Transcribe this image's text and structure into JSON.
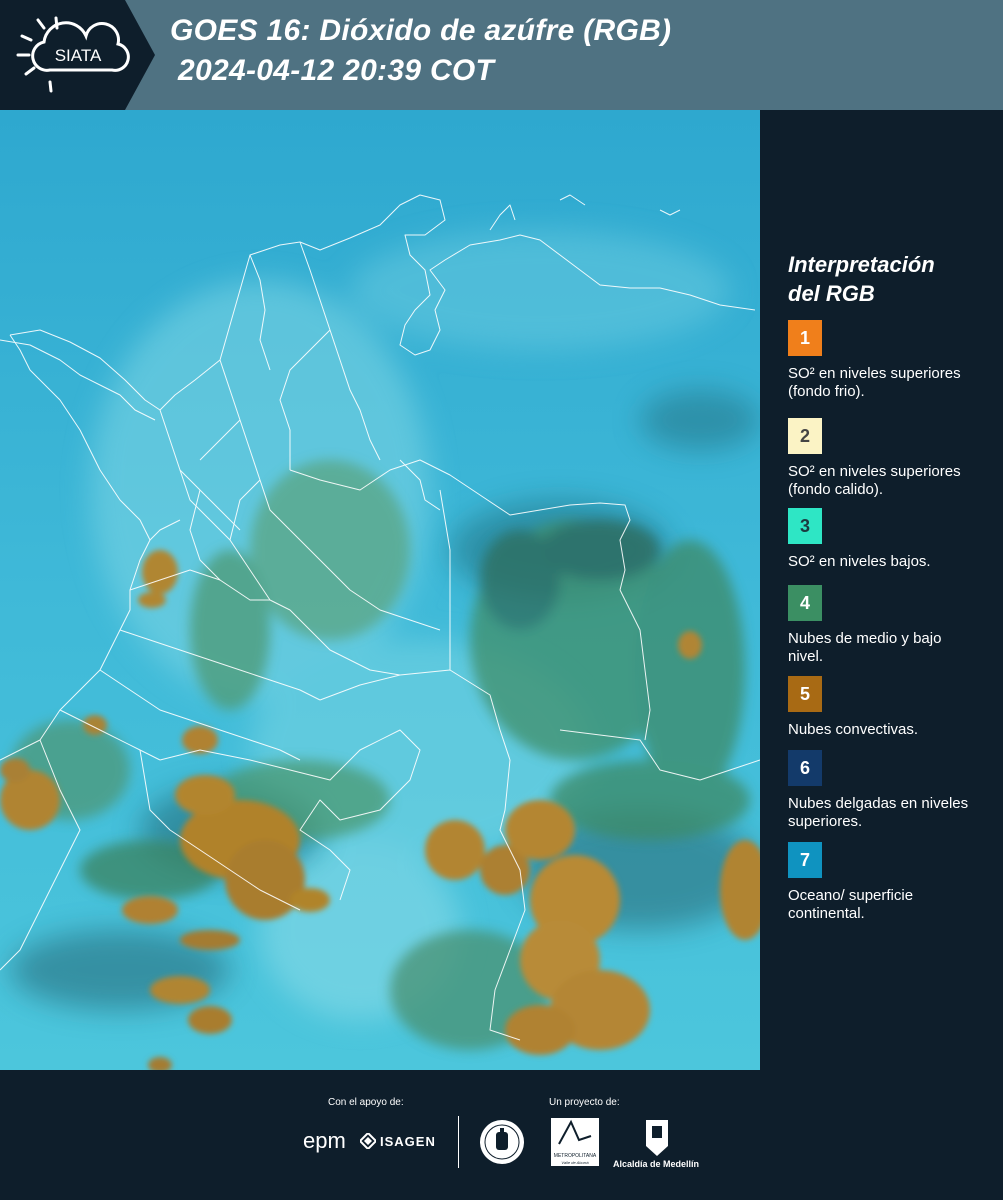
{
  "header": {
    "logo_text": "SIATA",
    "title_line1": "GOES 16: Dióxido de azúfre (RGB)",
    "title_line2": "2024-04-12 20:39 COT"
  },
  "legend": {
    "title_line1": "Interpretación",
    "title_line2": "del RGB",
    "items": [
      {
        "num": "1",
        "color": "#f07f1b",
        "text_color": "#ffffff",
        "label": "SO² en niveles superiores (fondo frio)."
      },
      {
        "num": "2",
        "color": "#fbf3c5",
        "text_color": "#444444",
        "label": "SO² en niveles superiores (fondo calido)."
      },
      {
        "num": "3",
        "color": "#2ee6c5",
        "text_color": "#1b3a40",
        "label": "SO² en niveles bajos."
      },
      {
        "num": "4",
        "color": "#3b8f63",
        "text_color": "#ffffff",
        "label": "Nubes de medio y bajo nivel."
      },
      {
        "num": "5",
        "color": "#a86a14",
        "text_color": "#ffffff",
        "label": "Nubes convectivas."
      },
      {
        "num": "6",
        "color": "#133a6a",
        "text_color": "#ffffff",
        "label": "Nubes delgadas en niveles superiores."
      },
      {
        "num": "7",
        "color": "#0f93c0",
        "text_color": "#ffffff",
        "label": "Oceano/ superficie continental."
      }
    ]
  },
  "footer": {
    "support_caption": "Con el apoyo de:",
    "project_caption": "Un proyecto de:",
    "epm": "epm",
    "isagen": "ISAGEN",
    "area_metropolitana": "METROPOLITANA",
    "area_sub": "Valle de Aburrá",
    "alcaldia": "Alcaldía de Medellín"
  },
  "colors": {
    "header_bg": "#4f7282",
    "panel_bg": "#0e1e2b",
    "map_sky": "#3fb9d6",
    "cloud_convective": "#b0822a",
    "cloud_low": "#3f8f5e",
    "border_lines": "#ffffff"
  }
}
